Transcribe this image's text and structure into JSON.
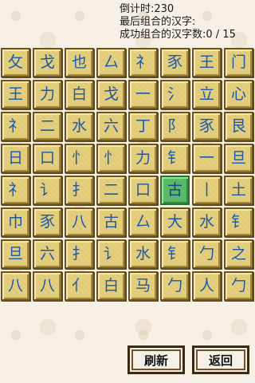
{
  "status": {
    "countdown": "倒计时:230",
    "last_combined": "最后组合的汉字:",
    "success_count": "成功组合的汉字数:0 / 15"
  },
  "board": {
    "rows": [
      [
        "攵",
        "戈",
        "也",
        "厶",
        "礻",
        "豕",
        "王",
        "门"
      ],
      [
        "王",
        "力",
        "白",
        "戈",
        "一",
        "氵",
        "立",
        "心"
      ],
      [
        "礻",
        "二",
        "水",
        "六",
        "丁",
        "阝",
        "豕",
        "艮"
      ],
      [
        "日",
        "口",
        "忄",
        "忄",
        "力",
        "钅",
        "一",
        "旦"
      ],
      [
        "礻",
        "讠",
        "扌",
        "二",
        "口",
        "古",
        "丨",
        "土"
      ],
      [
        "巾",
        "豕",
        "八",
        "古",
        "厶",
        "大",
        "水",
        "钅"
      ],
      [
        "旦",
        "六",
        "扌",
        "讠",
        "水",
        "钅",
        "勹",
        "之"
      ],
      [
        "八",
        "八",
        "亻",
        "白",
        "马",
        "勹",
        "人",
        "勹"
      ]
    ],
    "selected": [
      4,
      5
    ]
  },
  "buttons": {
    "refresh": "刷新",
    "back": "返回"
  },
  "colors": {
    "tile": "#e1cb76",
    "tile_selected": "#5ab969",
    "glyph": "#1d57a6"
  }
}
